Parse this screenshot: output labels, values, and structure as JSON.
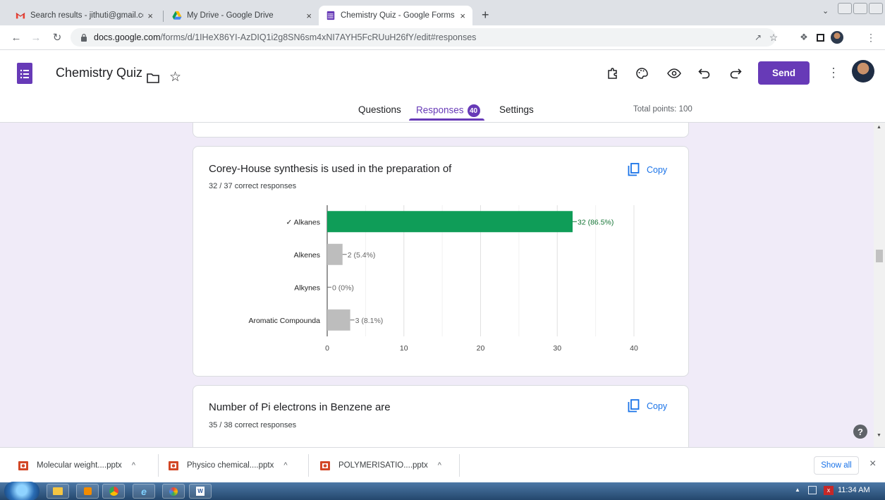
{
  "browser": {
    "tabs": [
      {
        "title": "Search results - jithuti@gmail.com",
        "close": "×"
      },
      {
        "title": "My Drive - Google Drive",
        "close": "×"
      },
      {
        "title": "Chemistry Quiz - Google Forms",
        "close": "×"
      }
    ],
    "new_tab": "+",
    "url_host": "docs.google.com",
    "url_path": "/forms/d/1IHeX86YI-AzDIQ1i2g8SN6sm4xNI7AYH5FcRUuH26fY/edit#responses"
  },
  "form": {
    "title": "Chemistry Quiz",
    "send_label": "Send",
    "tabs": {
      "questions": "Questions",
      "responses": "Responses",
      "settings": "Settings"
    },
    "responses_count": "40",
    "total_points": "Total points: 100",
    "accent": "#673ab7"
  },
  "questions": [
    {
      "title": "Corey-House synthesis is used in the preparation of",
      "correct": "32 / 37 correct responses",
      "copy_label": "Copy"
    },
    {
      "title": "Number of Pi electrons in Benzene are",
      "correct": "35 / 38 correct responses",
      "copy_label": "Copy"
    }
  ],
  "chart_data": {
    "type": "bar",
    "orientation": "horizontal",
    "categories": [
      "✓ Alkanes",
      "Alkenes",
      "Alkynes",
      "Aromatic Compounda"
    ],
    "values": [
      32,
      2,
      0,
      3
    ],
    "data_labels": [
      "32 (86.5%)",
      "2 (5.4%)",
      "0 (0%)",
      "3 (8.1%)"
    ],
    "correct_index": 0,
    "colors": {
      "correct": "#0f9d58",
      "other": "#bdbdbd",
      "correct_label": "#137333"
    },
    "xlim": [
      0,
      40
    ],
    "xticks": [
      0,
      10,
      20,
      30,
      40
    ],
    "grid": true
  },
  "downloads": {
    "items": [
      "Molecular weight....pptx",
      "Physico chemical....pptx",
      "POLYMERISATIO....pptx"
    ],
    "caret": "^",
    "show_all": "Show all",
    "close": "×"
  },
  "taskbar": {
    "time": "11:34 AM"
  }
}
